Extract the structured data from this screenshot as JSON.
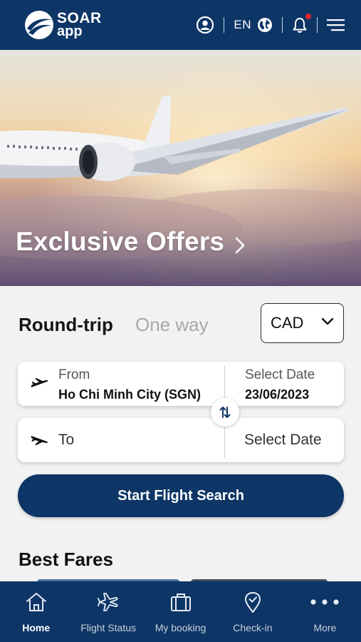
{
  "header": {
    "logo_line1": "SOAR",
    "logo_line2": "app",
    "language": "EN",
    "icons": [
      "profile-icon",
      "globe-icon",
      "bell-icon",
      "menu-icon"
    ],
    "notification_dot": true
  },
  "hero": {
    "title": "Exclusive Offers"
  },
  "search": {
    "trip_types": [
      "Round-trip",
      "One way"
    ],
    "selected_trip_type": "Round-trip",
    "currency": "CAD",
    "from_label": "From",
    "from_value": "Ho Chi Minh City (SGN)",
    "from_date_label": "Select Date",
    "from_date_value": "23/06/2023",
    "to_label": "To",
    "to_date_label": "Select Date",
    "search_button": "Start Flight Search"
  },
  "best_fares": {
    "title": "Best Fares"
  },
  "bottom_nav": {
    "items": [
      {
        "label": "Home",
        "icon": "home-icon",
        "active": true
      },
      {
        "label": "Flight Status",
        "icon": "plane-icon",
        "active": false
      },
      {
        "label": "My booking",
        "icon": "briefcase-icon",
        "active": false
      },
      {
        "label": "Check-in",
        "icon": "location-check-icon",
        "active": false
      },
      {
        "label": "More",
        "icon": "more-dots-icon",
        "active": false
      }
    ]
  },
  "colors": {
    "brand_navy": "#0d3566",
    "notification_red": "#e5262b",
    "page_background": "#f2f2f3"
  }
}
